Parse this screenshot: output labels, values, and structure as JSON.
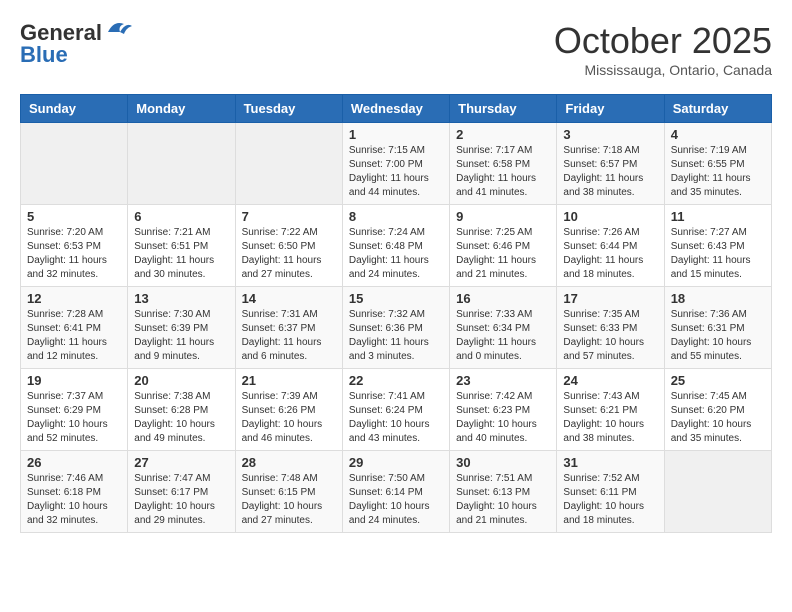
{
  "header": {
    "logo_general": "General",
    "logo_blue": "Blue",
    "month_title": "October 2025",
    "location": "Mississauga, Ontario, Canada"
  },
  "days_of_week": [
    "Sunday",
    "Monday",
    "Tuesday",
    "Wednesday",
    "Thursday",
    "Friday",
    "Saturday"
  ],
  "weeks": [
    [
      {
        "day": "",
        "info": ""
      },
      {
        "day": "",
        "info": ""
      },
      {
        "day": "",
        "info": ""
      },
      {
        "day": "1",
        "info": "Sunrise: 7:15 AM\nSunset: 7:00 PM\nDaylight: 11 hours and 44 minutes."
      },
      {
        "day": "2",
        "info": "Sunrise: 7:17 AM\nSunset: 6:58 PM\nDaylight: 11 hours and 41 minutes."
      },
      {
        "day": "3",
        "info": "Sunrise: 7:18 AM\nSunset: 6:57 PM\nDaylight: 11 hours and 38 minutes."
      },
      {
        "day": "4",
        "info": "Sunrise: 7:19 AM\nSunset: 6:55 PM\nDaylight: 11 hours and 35 minutes."
      }
    ],
    [
      {
        "day": "5",
        "info": "Sunrise: 7:20 AM\nSunset: 6:53 PM\nDaylight: 11 hours and 32 minutes."
      },
      {
        "day": "6",
        "info": "Sunrise: 7:21 AM\nSunset: 6:51 PM\nDaylight: 11 hours and 30 minutes."
      },
      {
        "day": "7",
        "info": "Sunrise: 7:22 AM\nSunset: 6:50 PM\nDaylight: 11 hours and 27 minutes."
      },
      {
        "day": "8",
        "info": "Sunrise: 7:24 AM\nSunset: 6:48 PM\nDaylight: 11 hours and 24 minutes."
      },
      {
        "day": "9",
        "info": "Sunrise: 7:25 AM\nSunset: 6:46 PM\nDaylight: 11 hours and 21 minutes."
      },
      {
        "day": "10",
        "info": "Sunrise: 7:26 AM\nSunset: 6:44 PM\nDaylight: 11 hours and 18 minutes."
      },
      {
        "day": "11",
        "info": "Sunrise: 7:27 AM\nSunset: 6:43 PM\nDaylight: 11 hours and 15 minutes."
      }
    ],
    [
      {
        "day": "12",
        "info": "Sunrise: 7:28 AM\nSunset: 6:41 PM\nDaylight: 11 hours and 12 minutes."
      },
      {
        "day": "13",
        "info": "Sunrise: 7:30 AM\nSunset: 6:39 PM\nDaylight: 11 hours and 9 minutes."
      },
      {
        "day": "14",
        "info": "Sunrise: 7:31 AM\nSunset: 6:37 PM\nDaylight: 11 hours and 6 minutes."
      },
      {
        "day": "15",
        "info": "Sunrise: 7:32 AM\nSunset: 6:36 PM\nDaylight: 11 hours and 3 minutes."
      },
      {
        "day": "16",
        "info": "Sunrise: 7:33 AM\nSunset: 6:34 PM\nDaylight: 11 hours and 0 minutes."
      },
      {
        "day": "17",
        "info": "Sunrise: 7:35 AM\nSunset: 6:33 PM\nDaylight: 10 hours and 57 minutes."
      },
      {
        "day": "18",
        "info": "Sunrise: 7:36 AM\nSunset: 6:31 PM\nDaylight: 10 hours and 55 minutes."
      }
    ],
    [
      {
        "day": "19",
        "info": "Sunrise: 7:37 AM\nSunset: 6:29 PM\nDaylight: 10 hours and 52 minutes."
      },
      {
        "day": "20",
        "info": "Sunrise: 7:38 AM\nSunset: 6:28 PM\nDaylight: 10 hours and 49 minutes."
      },
      {
        "day": "21",
        "info": "Sunrise: 7:39 AM\nSunset: 6:26 PM\nDaylight: 10 hours and 46 minutes."
      },
      {
        "day": "22",
        "info": "Sunrise: 7:41 AM\nSunset: 6:24 PM\nDaylight: 10 hours and 43 minutes."
      },
      {
        "day": "23",
        "info": "Sunrise: 7:42 AM\nSunset: 6:23 PM\nDaylight: 10 hours and 40 minutes."
      },
      {
        "day": "24",
        "info": "Sunrise: 7:43 AM\nSunset: 6:21 PM\nDaylight: 10 hours and 38 minutes."
      },
      {
        "day": "25",
        "info": "Sunrise: 7:45 AM\nSunset: 6:20 PM\nDaylight: 10 hours and 35 minutes."
      }
    ],
    [
      {
        "day": "26",
        "info": "Sunrise: 7:46 AM\nSunset: 6:18 PM\nDaylight: 10 hours and 32 minutes."
      },
      {
        "day": "27",
        "info": "Sunrise: 7:47 AM\nSunset: 6:17 PM\nDaylight: 10 hours and 29 minutes."
      },
      {
        "day": "28",
        "info": "Sunrise: 7:48 AM\nSunset: 6:15 PM\nDaylight: 10 hours and 27 minutes."
      },
      {
        "day": "29",
        "info": "Sunrise: 7:50 AM\nSunset: 6:14 PM\nDaylight: 10 hours and 24 minutes."
      },
      {
        "day": "30",
        "info": "Sunrise: 7:51 AM\nSunset: 6:13 PM\nDaylight: 10 hours and 21 minutes."
      },
      {
        "day": "31",
        "info": "Sunrise: 7:52 AM\nSunset: 6:11 PM\nDaylight: 10 hours and 18 minutes."
      },
      {
        "day": "",
        "info": ""
      }
    ]
  ]
}
